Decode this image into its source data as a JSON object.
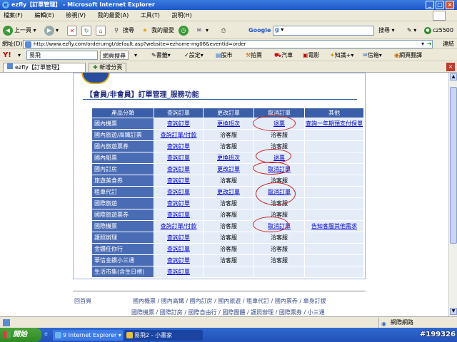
{
  "window": {
    "title": "ezfly【訂單管理】 - Microsoft Internet Explorer",
    "min": "_",
    "max": "□",
    "close": "×"
  },
  "menu": [
    "檔案(F)",
    "編輯(E)",
    "檢視(V)",
    "我的最愛(A)",
    "工具(T)",
    "說明(H)"
  ],
  "toolbar": {
    "back": "上一頁",
    "search": "搜尋",
    "favorites": "我的最愛",
    "google_label": "Google",
    "google_search": "搜尋",
    "user": "cz5500"
  },
  "address": {
    "label": "網址(D)",
    "url": "http://www.ezfly.com/orderumgt/default.asp?website=ezhome-mg06&eventid=order",
    "go": "移至",
    "links": "連結"
  },
  "yahoo": {
    "logo": "Y!",
    "query": "易飛",
    "web_search": "網頁搜尋",
    "items": [
      "書籤",
      "設定",
      "股市",
      "拍賣",
      "汽車",
      "電影",
      "知識+",
      "信箱",
      "網頁翻譯"
    ]
  },
  "tabs": {
    "active": "ezfly【訂單管理】",
    "new_tab": "新增分頁"
  },
  "page": {
    "section_title": "【會員/非會員】訂單管理_服務功能",
    "headers": [
      "產品分類",
      "查詢訂單",
      "更改訂單",
      "取消訂單",
      "其他"
    ],
    "rows": [
      {
        "cat": "國內機票",
        "query": "查詢訂單",
        "change": "更換班次",
        "cancel": "退票",
        "other": "查詢一年期預支付保單"
      },
      {
        "cat": "國內旅遊/高鐵訂票",
        "query": "查詢訂單/付款",
        "change": "洽客服",
        "cancel": "洽客服",
        "other": ""
      },
      {
        "cat": "國內旅遊票券",
        "query": "查詢訂單",
        "change": "洽客服",
        "cancel": "洽客服",
        "other": ""
      },
      {
        "cat": "國內船票",
        "query": "查詢訂單",
        "change": "更換班次",
        "cancel": "退票",
        "other": ""
      },
      {
        "cat": "國內訂房",
        "query": "查詢訂單",
        "change": "更改訂單",
        "cancel": "取消訂單",
        "other": ""
      },
      {
        "cat": "旅遊美食券",
        "query": "查詢訂單",
        "change": "洽客服",
        "cancel": "洽客服",
        "other": ""
      },
      {
        "cat": "租車代訂",
        "query": "查詢訂單",
        "change": "更改訂單",
        "cancel": "取消訂單",
        "other": ""
      },
      {
        "cat": "國際旅遊",
        "query": "查詢訂單",
        "change": "洽客服",
        "cancel": "洽客服",
        "other": ""
      },
      {
        "cat": "國際旅遊票券",
        "query": "查詢訂單",
        "change": "洽客服",
        "cancel": "洽客服",
        "other": ""
      },
      {
        "cat": "國際機票",
        "query": "查詢訂單/付款",
        "change": "洽客服",
        "cancel": "取消訂單",
        "other": "告知客服其他需求"
      },
      {
        "cat": "護照辦理",
        "query": "查詢訂單",
        "change": "洽客服",
        "cancel": "洽客服",
        "other": ""
      },
      {
        "cat": "金鑽任你行",
        "query": "查詢訂單",
        "change": "洽客服",
        "cancel": "洽客服",
        "other": ""
      },
      {
        "cat": "華信金鑽小三通",
        "query": "查詢訂單",
        "change": "洽客服",
        "cancel": "洽客服",
        "other": ""
      },
      {
        "cat": "生活市集(含生日禮)",
        "query": "查詢訂單",
        "change": "",
        "cancel": "",
        "other": ""
      }
    ],
    "footer": {
      "home": "回首頁",
      "row1": "國內機票 / 國內高鐵 / 國內訂房 / 國內旅遊 / 租車代訂 / 國內票券 / 車身訂拔",
      "row2": "國際機票 / 國際訂房 / 國際自由行 / 國際團體 / 護照辦理 / 國際票券 / 小三通"
    }
  },
  "status": {
    "zone": "網際網路"
  },
  "taskbar": {
    "start": "開始",
    "tasks": [
      "9 Internet Explorer",
      "易飛2 - 小畫家"
    ],
    "watermark": "#199326"
  }
}
